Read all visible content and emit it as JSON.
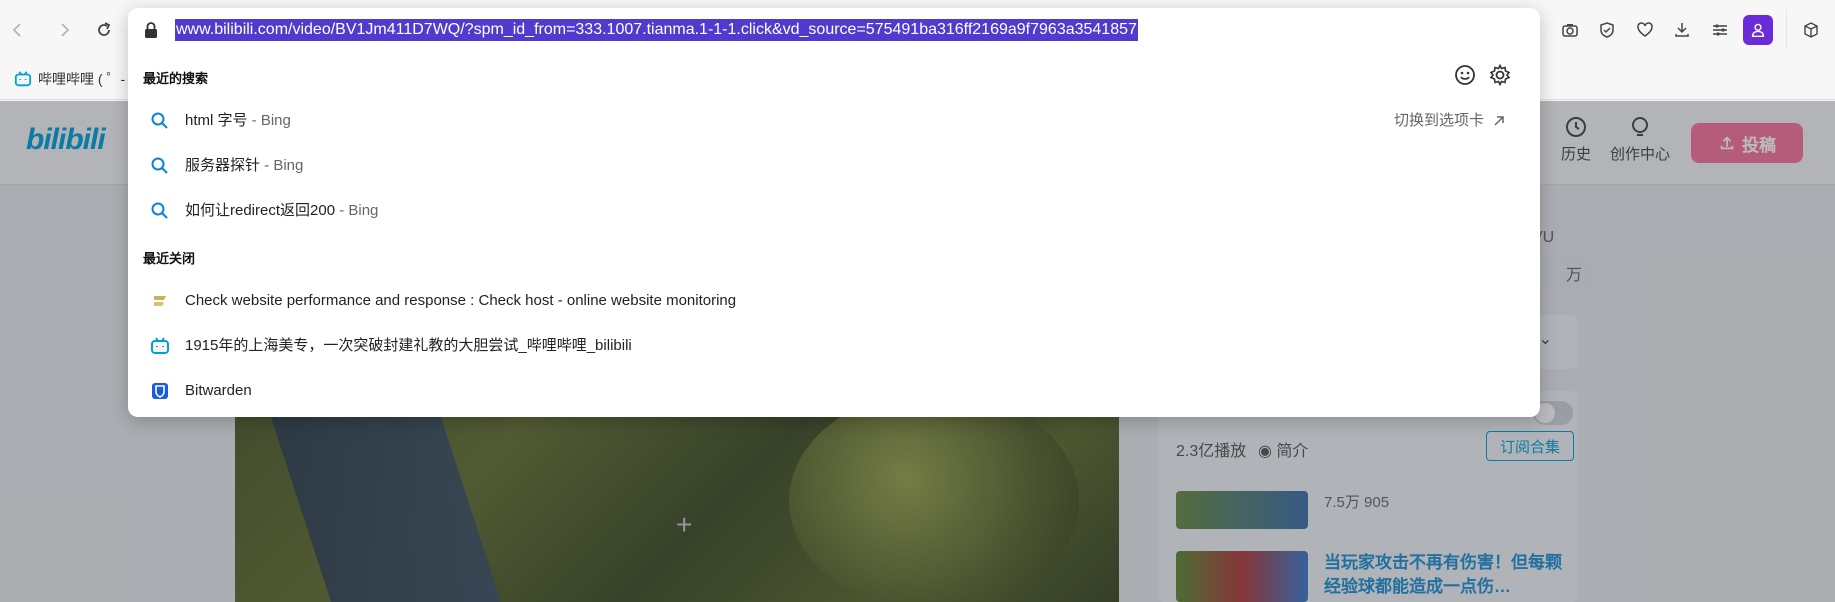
{
  "browser": {
    "url": "www.bilibili.com/video/BV1Jm411D7WQ/?spm_id_from=333.1007.tianma.1-1-1.click&vd_source=575491ba316ff2169a9f7963a3541857",
    "bookmark_label": "哔哩哔哩 ( ゜-"
  },
  "omnibox": {
    "recent_searches_label": "最近的搜索",
    "recent_closed_label": "最近关闭",
    "searches": [
      {
        "query": "html 字号",
        "engine": " - Bing",
        "action": "切换到选项卡"
      },
      {
        "query": "服务器探针",
        "engine": " - Bing"
      },
      {
        "query": "如何让redirect返回200",
        "engine": " - Bing"
      }
    ],
    "closed": [
      {
        "title": "Check website performance and response : Check host - online website monitoring",
        "icon": "checkhost-icon"
      },
      {
        "title": "1915年的上海美专，一次突破封建礼教的大胆尝试_哔哩哔哩_bilibili",
        "icon": "bilibili-icon"
      },
      {
        "title": "Bitwarden",
        "icon": "bitwarden-icon"
      }
    ]
  },
  "page": {
    "logo": "bilibili",
    "history_label": "历史",
    "creator_label": "创作中心",
    "upload_label": "投稿",
    "rank_label": "VU",
    "rank_value": "万",
    "play_count": "2.3亿播放",
    "intro_label": "简介",
    "subscribe_label": "订阅合集",
    "rec1_meta": "7.5万   905",
    "rec2_title": "当玩家攻击不再有伤害！但每颗经验球都能造成一点伤…"
  },
  "colors": {
    "selection": "#4f3ccf",
    "accent": "#00a1d6",
    "upload": "#f87298",
    "profile": "#6c2bd9"
  }
}
